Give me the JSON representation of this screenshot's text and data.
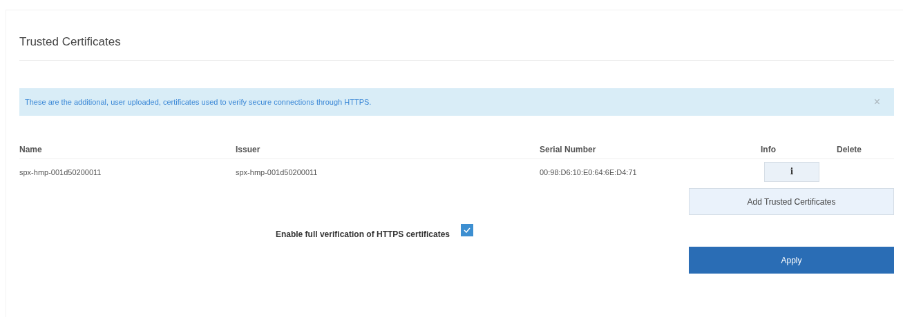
{
  "title": "Trusted Certificates",
  "alert": {
    "text": "These are the additional, user uploaded, certificates used to verify secure connections through HTTPS.",
    "close": "×"
  },
  "table": {
    "columns": [
      "Name",
      "Issuer",
      "Serial Number",
      "Info",
      "Delete"
    ],
    "rows": [
      {
        "name": "spx-hmp-001d50200011",
        "issuer": "spx-hmp-001d50200011",
        "serial": "00:98:D6:10:E0:64:6E:D4:71",
        "info": "i"
      }
    ]
  },
  "add_button": "Add Trusted Certificates",
  "verification": {
    "label": "Enable full verification of HTTPS certificates",
    "checked": true
  },
  "apply_button": "Apply"
}
